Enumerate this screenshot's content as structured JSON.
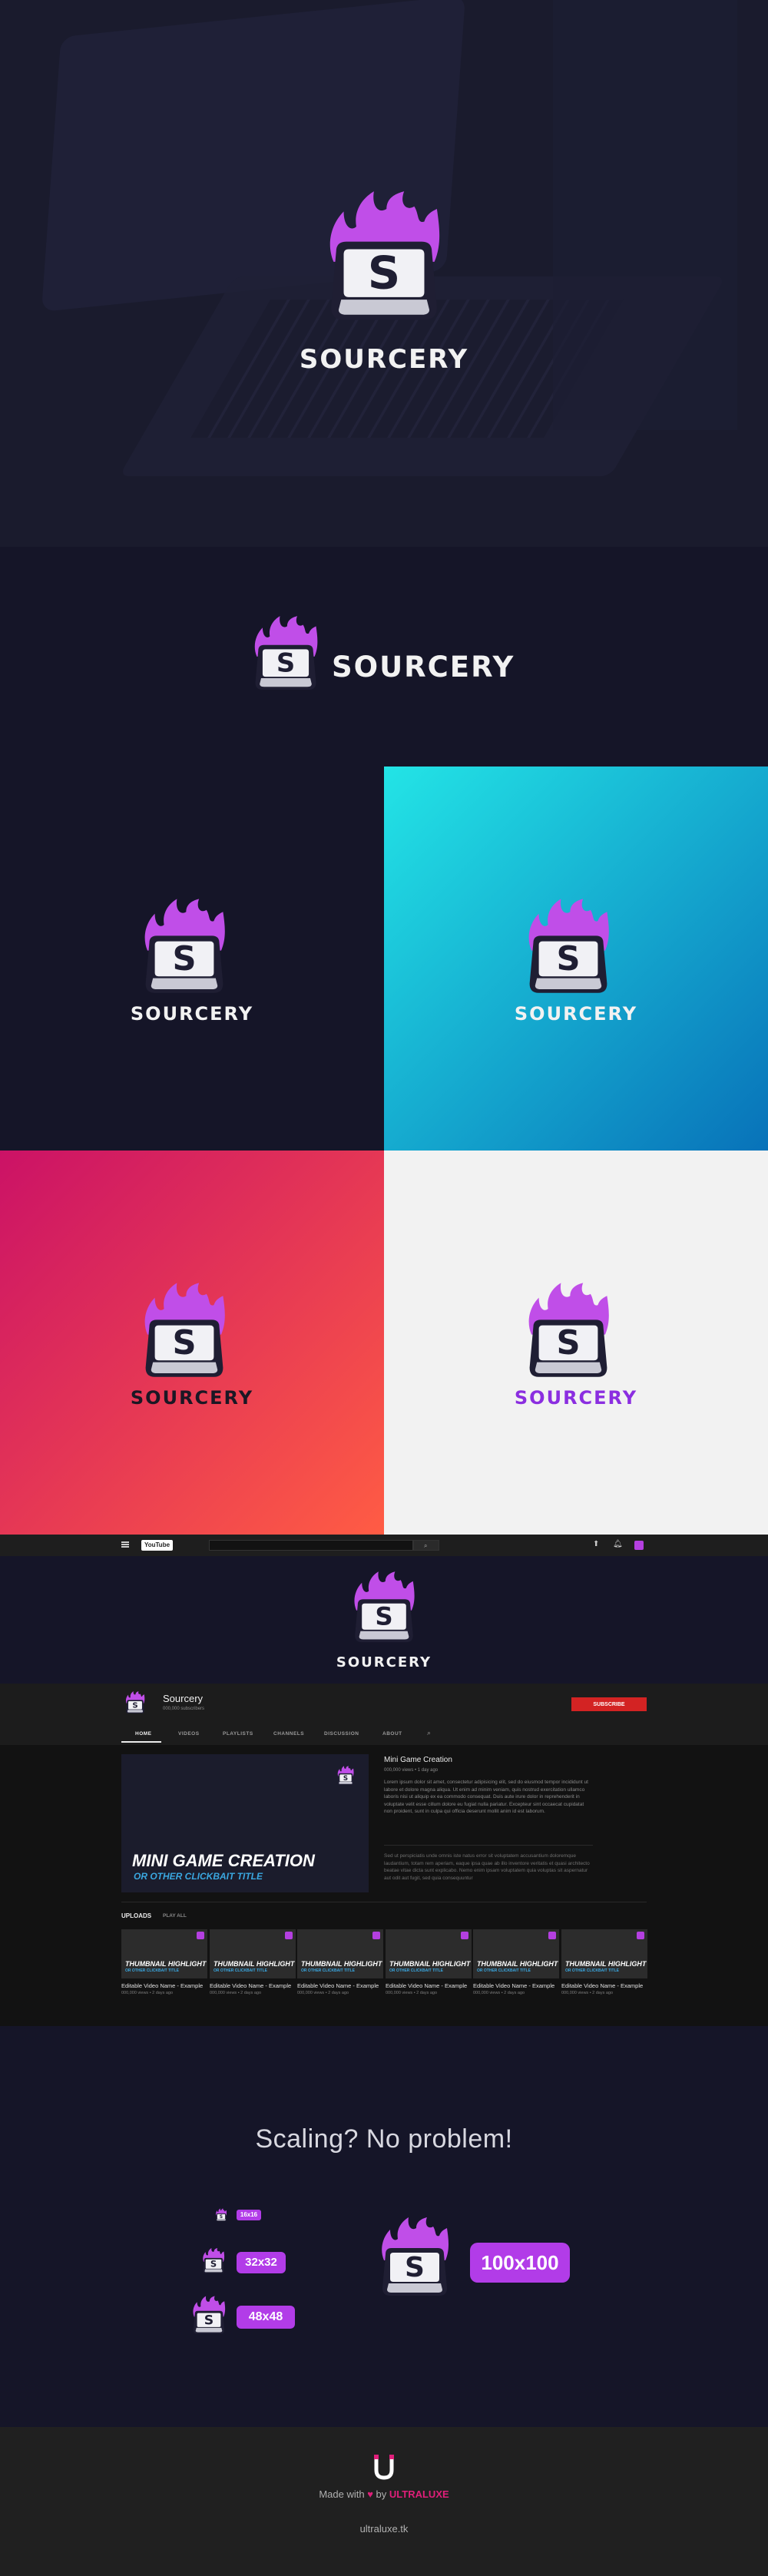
{
  "brand": {
    "name": "SOURCERY",
    "key_letter": "S"
  },
  "colors": {
    "purple_flame": "#b43fe0",
    "purple_key": "#7c2fd1",
    "dark_bg": "#151528",
    "subscribe_red": "#d32323",
    "ultraluxe_pink": "#e01f7a"
  },
  "youtube": {
    "logo": "YouTube",
    "channel_name": "Sourcery",
    "subscriber_count": "000,000 subscribers",
    "subscribe_label": "SUBSCRIBE",
    "tabs": [
      "HOME",
      "VIDEOS",
      "PLAYLISTS",
      "CHANNELS",
      "DISCUSSION",
      "ABOUT"
    ],
    "featured": {
      "title_line1": "MINI GAME CREATION",
      "title_line2": "OR OTHER CLICKBAIT TITLE",
      "video_title": "Mini Game Creation",
      "meta": "000,000 views • 1 day ago",
      "description1": "Lorem ipsum dolor sit amet, consectetur adipisicing elit, sed do eiusmod tempor incididunt ut labore et dolore magna aliqua. Ut enim ad minim veniam, quis nostrud exercitation ullamco laboris nisi ut aliquip ex ea commodo consequat. Duis aute irure dolor in reprehenderit in voluptate velit esse cillum dolore eu fugiat nulla pariatur. Excepteur sint occaecat cupidatat non proident, sunt in culpa qui officia deserunt mollit anim id est laborum.",
      "description2": "Sed ut perspiciatis unde omnis iste natus error sit voluptatem accusantium doloremque laudantium, totam rem aperiam, eaque ipsa quae ab illo inventore veritatis et quasi architecto beatae vitae dicta sunt explicabo. Nemo enim ipsam voluptatem quia voluptas sit aspernatur aut odit aut fugit, sed quia consequuntur"
    },
    "uploads_label": "UPLOADS",
    "play_all_label": "PLAY ALL",
    "uploads": [
      {
        "highlight": "THUMBNAIL HIGHLIGHT",
        "sub": "OR OTHER CLICKBAIT TITLE",
        "title": "Editable Video Name - Example",
        "meta": "000,000 views • 2 days ago"
      },
      {
        "highlight": "THUMBNAIL HIGHLIGHT",
        "sub": "OR OTHER CLICKBAIT TITLE",
        "title": "Editable Video Name - Example",
        "meta": "000,000 views • 2 days ago"
      },
      {
        "highlight": "THUMBNAIL HIGHLIGHT",
        "sub": "OR OTHER CLICKBAIT TITLE",
        "title": "Editable Video Name - Example",
        "meta": "000,000 views • 2 days ago"
      },
      {
        "highlight": "THUMBNAIL HIGHLIGHT",
        "sub": "OR OTHER CLICKBAIT TITLE",
        "title": "Editable Video Name - Example",
        "meta": "000,000 views • 2 days ago"
      },
      {
        "highlight": "THUMBNAIL HIGHLIGHT",
        "sub": "OR OTHER CLICKBAIT TITLE",
        "title": "Editable Video Name - Example",
        "meta": "000,000 views • 2 days ago"
      },
      {
        "highlight": "THUMBNAIL HIGHLIGHT",
        "sub": "OR OTHER CLICKBAIT TITLE",
        "title": "Editable Video Name - Example",
        "meta": "000,000 views • 2 days ago"
      }
    ]
  },
  "scaling": {
    "heading": "Scaling? No problem!",
    "sizes": [
      "16x16",
      "32x32",
      "48x48",
      "100x100"
    ]
  },
  "footer": {
    "made_with": "Made with",
    "by": "by",
    "brand": "ULTRALUXE",
    "url": "ultraluxe.tk"
  }
}
